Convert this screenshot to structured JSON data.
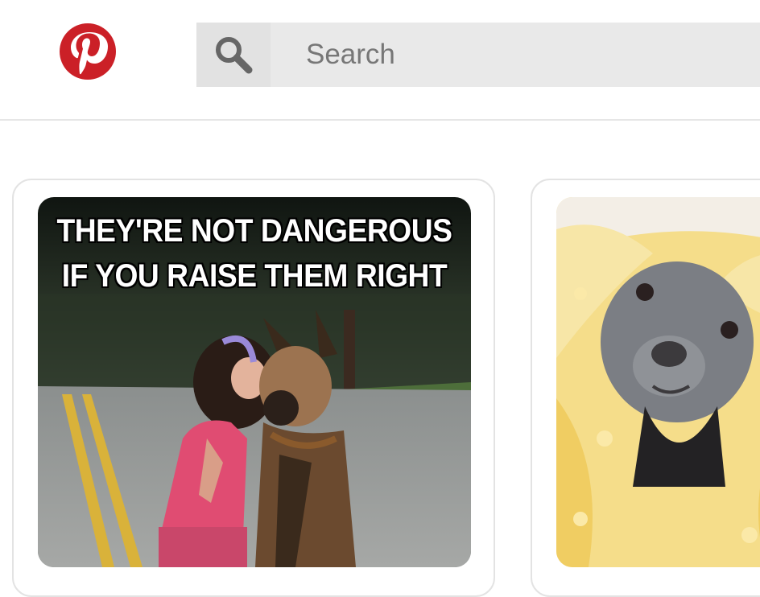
{
  "header": {
    "logo_icon": "pinterest-logo-icon",
    "brand_color": "#cb2027",
    "search": {
      "icon": "search-icon",
      "placeholder": "Search",
      "value": ""
    }
  },
  "feed": {
    "pins": [
      {
        "caption_line_1": "THEY'RE NOT DANGEROUS",
        "caption_line_2": "IF YOU RAISE THEM RIGHT"
      },
      {}
    ]
  }
}
